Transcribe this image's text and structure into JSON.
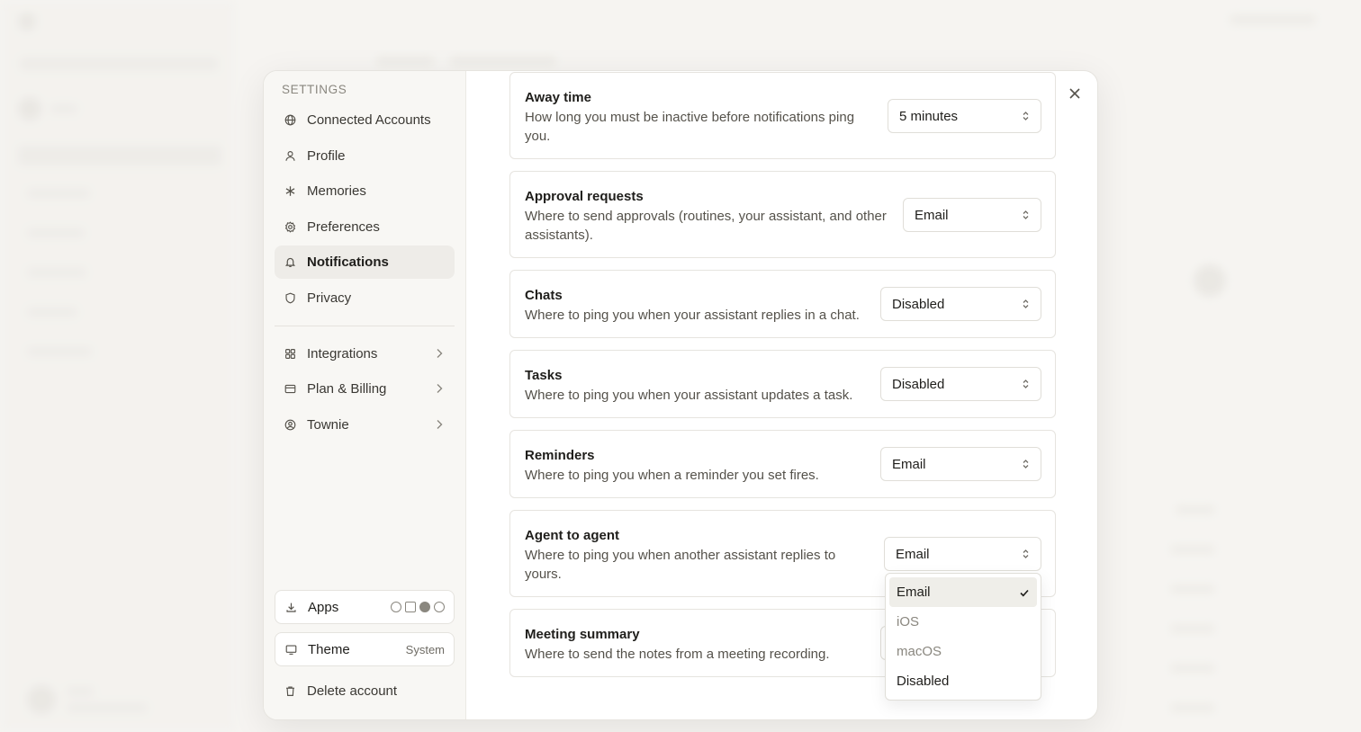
{
  "settings_nav": {
    "heading": "SETTINGS",
    "items": [
      {
        "label": "Connected Accounts",
        "icon": "globe-icon"
      },
      {
        "label": "Profile",
        "icon": "user-icon"
      },
      {
        "label": "Memories",
        "icon": "asterisk-icon"
      },
      {
        "label": "Preferences",
        "icon": "gear-icon"
      },
      {
        "label": "Notifications",
        "icon": "bell-icon",
        "active": true
      },
      {
        "label": "Privacy",
        "icon": "shield-icon"
      }
    ],
    "sub_items": [
      {
        "label": "Integrations",
        "icon": "grid-icon"
      },
      {
        "label": "Plan & Billing",
        "icon": "credit-card-icon"
      },
      {
        "label": "Townie",
        "icon": "user-circle-icon"
      }
    ],
    "apps_label": "Apps",
    "theme_label": "Theme",
    "theme_value": "System",
    "delete_label": "Delete account"
  },
  "notifications": [
    {
      "title": "Away time",
      "desc": "How long you must be inactive before notifications ping you.",
      "value": "5 minutes"
    },
    {
      "title": "Approval requests",
      "desc": "Where to send approvals (routines, your assistant, and other assistants).",
      "value": "Email"
    },
    {
      "title": "Chats",
      "desc": "Where to ping you when your assistant replies in a chat.",
      "value": "Disabled"
    },
    {
      "title": "Tasks",
      "desc": "Where to ping you when your assistant updates a task.",
      "value": "Disabled"
    },
    {
      "title": "Reminders",
      "desc": "Where to ping you when a reminder you set fires.",
      "value": "Email"
    },
    {
      "title": "Agent to agent",
      "desc": "Where to ping you when another assistant replies to yours.",
      "value": "Email"
    },
    {
      "title": "Meeting summary",
      "desc": "Where to send the notes from a meeting recording.",
      "value": ""
    }
  ],
  "dropdown": {
    "options": [
      {
        "label": "Email",
        "selected": true
      },
      {
        "label": "iOS",
        "dim": true
      },
      {
        "label": "macOS",
        "dim": true
      },
      {
        "label": "Disabled"
      }
    ]
  },
  "colors": {
    "accent": "#1f1e1b",
    "muted": "#8a877f",
    "background": "#f6f5f1"
  }
}
